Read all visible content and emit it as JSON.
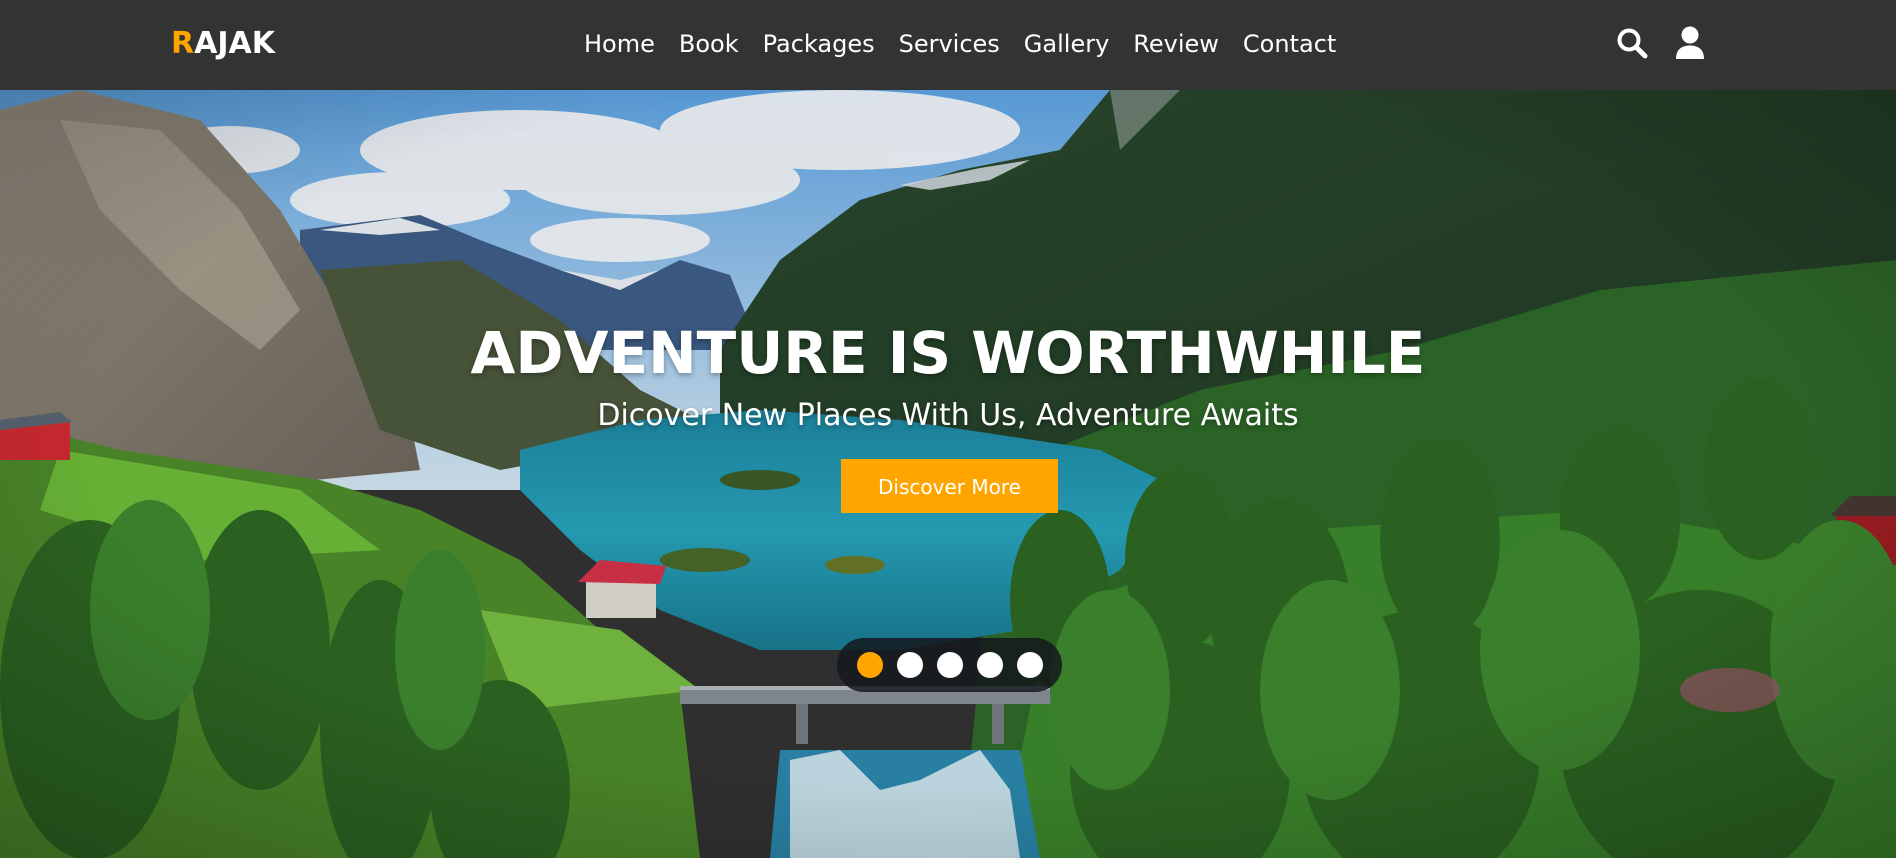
{
  "brand": {
    "first_letter": "R",
    "rest": "AJAK",
    "accent_color": "#ffa500"
  },
  "nav": {
    "items": [
      {
        "label": "Home"
      },
      {
        "label": "Book"
      },
      {
        "label": "Packages"
      },
      {
        "label": "Services"
      },
      {
        "label": "Gallery"
      },
      {
        "label": "Review"
      },
      {
        "label": "Contact"
      }
    ]
  },
  "header_icons": [
    "search-icon",
    "user-icon"
  ],
  "hero": {
    "title": "ADVENTURE IS WORTHWHILE",
    "subtitle": "Dicover New Places With Us, Adventure Awaits",
    "button_label": "Discover More",
    "slider": {
      "total_slides": 5,
      "active_index": 0
    }
  },
  "colors": {
    "header_bg": "#333333",
    "button_bg": "#ffa500",
    "active_dot": "#ffa500",
    "inactive_dot": "#ffffff"
  }
}
